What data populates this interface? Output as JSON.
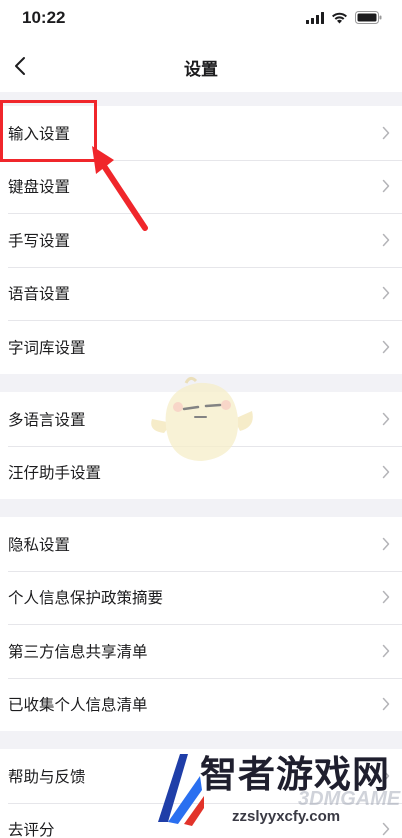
{
  "status_bar": {
    "time": "10:22",
    "icons": [
      "signal-icon",
      "wifi-icon",
      "battery-icon"
    ]
  },
  "nav": {
    "title": "设置",
    "back_icon": "chevron-left-icon"
  },
  "groups": [
    {
      "items": [
        {
          "label": "输入设置"
        },
        {
          "label": "键盘设置"
        },
        {
          "label": "手写设置"
        },
        {
          "label": "语音设置"
        },
        {
          "label": "字词库设置"
        }
      ]
    },
    {
      "items": [
        {
          "label": "多语言设置"
        },
        {
          "label": "汪仔助手设置"
        }
      ]
    },
    {
      "items": [
        {
          "label": "隐私设置"
        },
        {
          "label": "个人信息保护政策摘要"
        },
        {
          "label": "第三方信息共享清单"
        },
        {
          "label": "已收集个人信息清单"
        }
      ]
    },
    {
      "items": [
        {
          "label": "帮助与反馈"
        },
        {
          "label": "去评分"
        }
      ]
    }
  ],
  "annotation": {
    "color": "#f0262b"
  },
  "watermark": {
    "title": "智者游戏网",
    "url": "zzslyyxcfy.com",
    "brand": "3DMGAME"
  }
}
